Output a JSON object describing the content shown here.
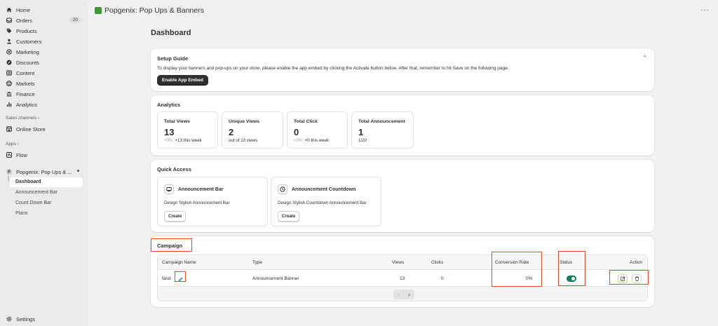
{
  "sidebar": {
    "items": [
      {
        "label": "Home",
        "icon": "home-icon"
      },
      {
        "label": "Orders",
        "icon": "inbox-icon",
        "badge": "20"
      },
      {
        "label": "Products",
        "icon": "tag-icon"
      },
      {
        "label": "Customers",
        "icon": "person-icon"
      },
      {
        "label": "Marketing",
        "icon": "target-icon"
      },
      {
        "label": "Discounts",
        "icon": "discount-icon"
      },
      {
        "label": "Content",
        "icon": "content-icon"
      },
      {
        "label": "Markets",
        "icon": "globe-icon"
      },
      {
        "label": "Finance",
        "icon": "bank-icon"
      },
      {
        "label": "Analytics",
        "icon": "chart-icon"
      }
    ],
    "sales_channels_label": "Sales channels ›",
    "online_store_label": "Online Store",
    "apps_label": "Apps ›",
    "flow_label": "Flow",
    "app_label": "Popgenix: Pop Ups & ...",
    "app_sub_items": [
      "Dashboard",
      "Announcement Bar",
      "Count Down Bar",
      "Plans"
    ],
    "settings_label": "Settings"
  },
  "topbar": {
    "title": "Popgenix: Pop Ups & Banners",
    "more": "···"
  },
  "page": {
    "title": "Dashboard"
  },
  "setup_guide": {
    "title": "Setup Guide",
    "text": "To display your banners and pop-ups on your store, please enable the app embed by clicking the Activate button below. After that, remember to hit Save on the following page.",
    "button": "Enable App Embed",
    "collapse": "⌃"
  },
  "analytics": {
    "title": "Analytics",
    "stats": [
      {
        "title": "Total Views",
        "value": "13",
        "delta": "+0%",
        "sub": "+13 this week"
      },
      {
        "title": "Unique Views",
        "value": "2",
        "delta": "",
        "sub": "out of 13 views"
      },
      {
        "title": "Total Click",
        "value": "0",
        "delta": "+0%",
        "sub": "+0 this week"
      },
      {
        "title": "Total Announcement",
        "value": "1",
        "delta": "",
        "sub": "1/20"
      }
    ]
  },
  "quick_access": {
    "title": "Quick Access",
    "cards": [
      {
        "title": "Announcement Bar",
        "desc": "Design Stylish Announcement Bar",
        "button": "Create",
        "icon": "bar-icon"
      },
      {
        "title": "Announcement Countdown",
        "desc": "Design Stylish Countdown Announcement Bar",
        "button": "Create",
        "icon": "clock-icon"
      }
    ]
  },
  "campaign": {
    "title": "Campaign",
    "columns": [
      "Campaign Name",
      "Type",
      "Views",
      "Clicks",
      "Conversion Rate",
      "Status",
      "Action"
    ],
    "rows": [
      {
        "name": "fasd",
        "type": "Announcement Banner",
        "views": "13",
        "clicks": "0",
        "conversion": "0%",
        "status_on": true
      }
    ],
    "pager_prev": "‹",
    "pager_next": "›"
  },
  "colors": {
    "accent_dark": "#303030",
    "toggle_on": "#147e5a",
    "highlight": "#e8482a",
    "edit_blue": "#2c6ecb"
  }
}
